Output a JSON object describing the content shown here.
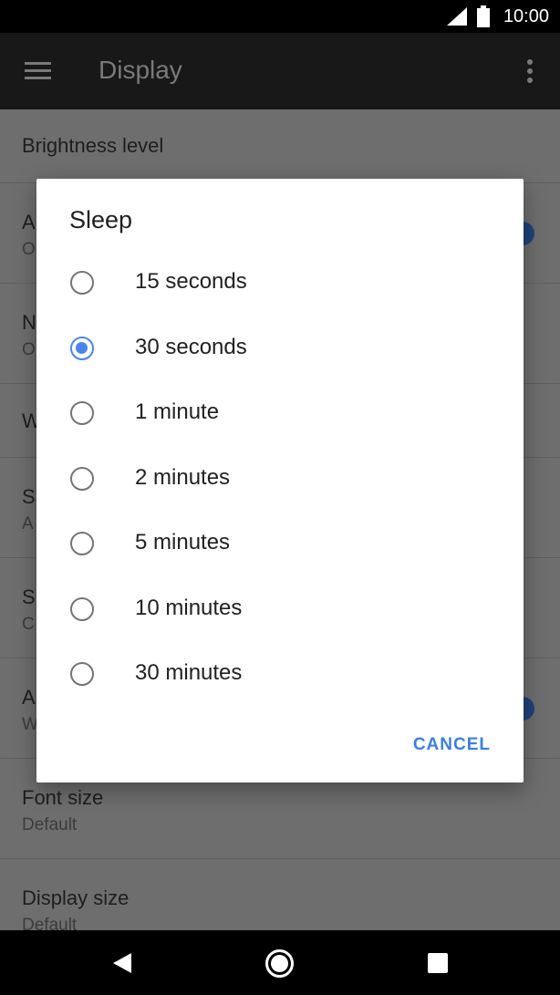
{
  "status_bar": {
    "time": "10:00"
  },
  "app_bar": {
    "title": "Display"
  },
  "settings": [
    {
      "title": "Brightness level",
      "subtitle": ""
    },
    {
      "title": "A",
      "subtitle": "O"
    },
    {
      "title": "N",
      "subtitle": "O"
    },
    {
      "title": "W",
      "subtitle": ""
    },
    {
      "title": "S",
      "subtitle": "A"
    },
    {
      "title": "S",
      "subtitle": "C"
    },
    {
      "title": "A",
      "subtitle": "W"
    },
    {
      "title": "Font size",
      "subtitle": "Default"
    },
    {
      "title": "Display size",
      "subtitle": "Default"
    }
  ],
  "dialog": {
    "title": "Sleep",
    "options": [
      {
        "label": "15 seconds",
        "checked": false
      },
      {
        "label": "30 seconds",
        "checked": true
      },
      {
        "label": "1 minute",
        "checked": false
      },
      {
        "label": "2 minutes",
        "checked": false
      },
      {
        "label": "5 minutes",
        "checked": false
      },
      {
        "label": "10 minutes",
        "checked": false
      },
      {
        "label": "30 minutes",
        "checked": false
      }
    ],
    "cancel_label": "CANCEL"
  },
  "colors": {
    "accent": "#4a86e8",
    "toggle_on": "#20427a"
  }
}
